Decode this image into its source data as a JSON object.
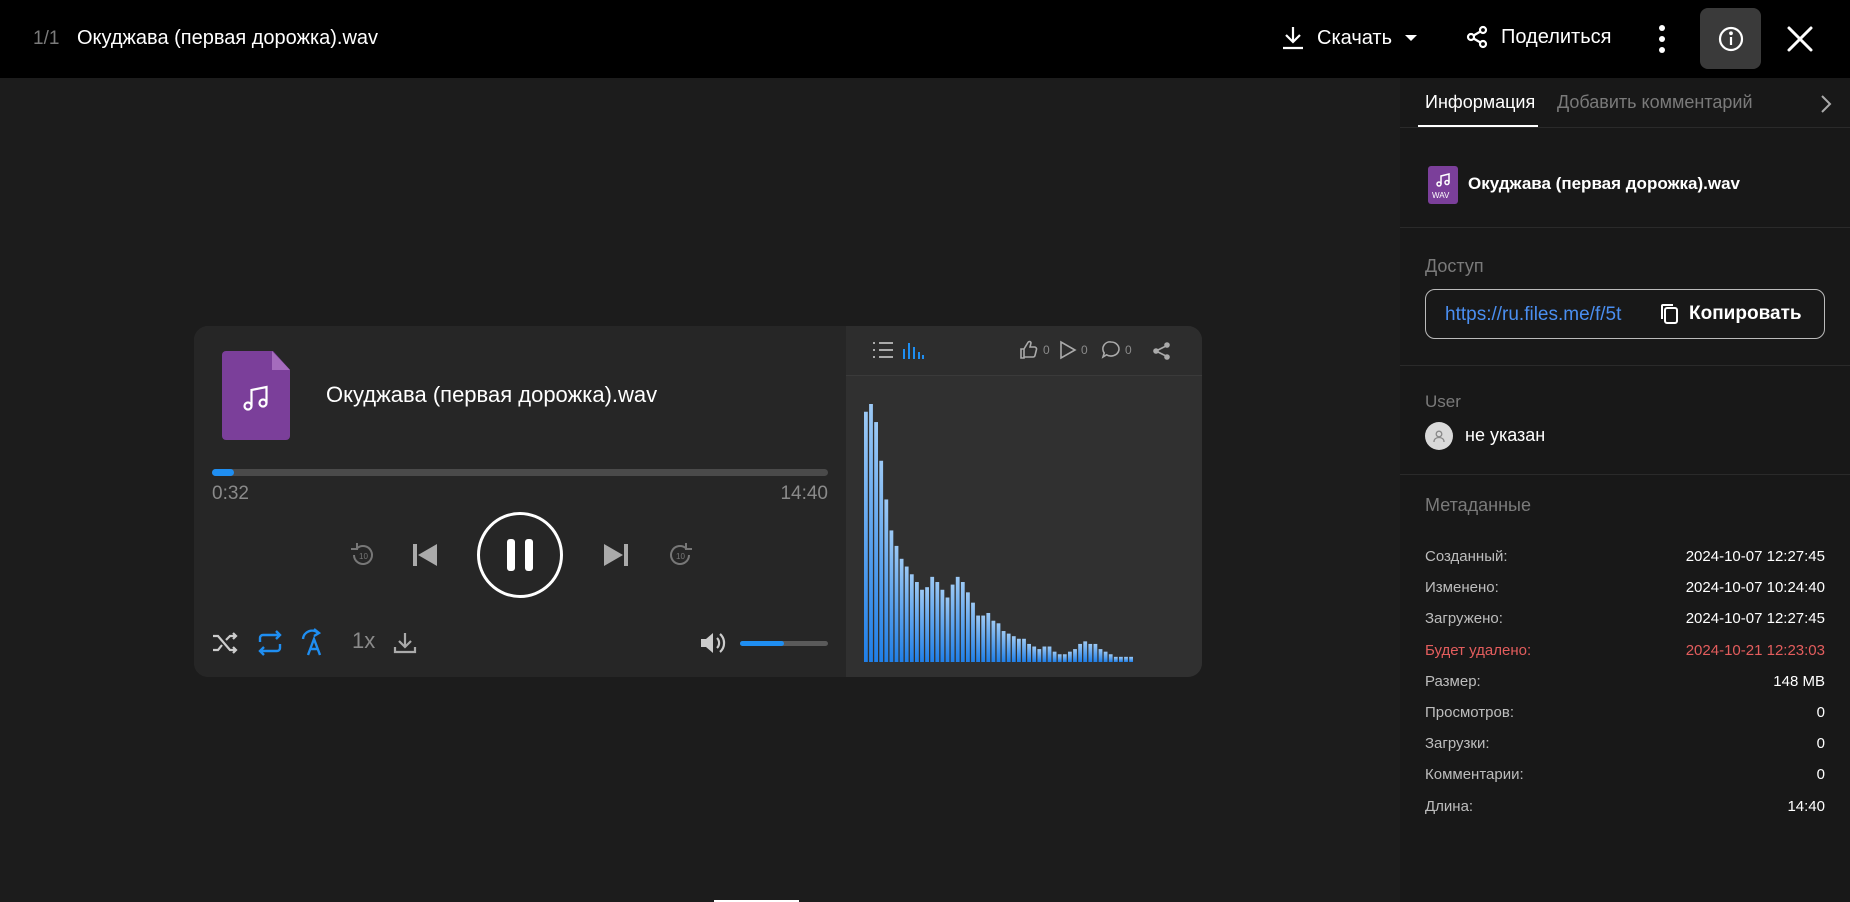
{
  "topbar": {
    "counter": "1/1",
    "title": "Окуджава (первая дорожка).wav",
    "download_label": "Скачать",
    "share_label": "Поделиться"
  },
  "player": {
    "file_title": "Окуджава (первая дорожка).wav",
    "current_time": "0:32",
    "total_time": "14:40",
    "progress": 0.036,
    "speed": "1x",
    "volume": 0.5,
    "accent_color": "#1f8ef1",
    "icons": [
      "replay-10-icon",
      "previous-icon",
      "pause-icon",
      "next-icon",
      "forward-10-icon",
      "shuffle-icon",
      "repeat-icon",
      "auto-translate-icon",
      "download-icon",
      "volume-icon"
    ]
  },
  "visualizer": {
    "likes": "0",
    "plays": "0",
    "comments": "0",
    "levels": [
      0.97,
      1.0,
      0.93,
      0.78,
      0.63,
      0.51,
      0.45,
      0.4,
      0.37,
      0.34,
      0.31,
      0.28,
      0.29,
      0.33,
      0.31,
      0.28,
      0.25,
      0.3,
      0.33,
      0.31,
      0.27,
      0.23,
      0.18,
      0.18,
      0.19,
      0.16,
      0.15,
      0.12,
      0.11,
      0.1,
      0.09,
      0.09,
      0.07,
      0.06,
      0.05,
      0.06,
      0.06,
      0.04,
      0.03,
      0.03,
      0.04,
      0.05,
      0.07,
      0.08,
      0.07,
      0.07,
      0.05,
      0.04,
      0.03,
      0.02,
      0.02,
      0.02,
      0.02
    ]
  },
  "panel": {
    "tab_info": "Информация",
    "tab_comment": "Добавить комментарий",
    "file_name": "Окуджава (первая дорожка).wav",
    "file_ext": "WAV",
    "access_label": "Доступ",
    "access_url": "https://ru.files.me/f/5t",
    "copy_label": "Копировать",
    "user_label": "User",
    "user_value": "не указан",
    "meta_label": "Метаданные",
    "meta": [
      {
        "k": "Созданный:",
        "v": "2024-10-07 12:27:45"
      },
      {
        "k": "Изменено:",
        "v": "2024-10-07 10:24:40"
      },
      {
        "k": "Загружено:",
        "v": "2024-10-07 12:27:45"
      },
      {
        "k": "Будет удалено:",
        "v": "2024-10-21 12:23:03"
      },
      {
        "k": "Размер:",
        "v": "148 MB"
      },
      {
        "k": "Просмотров:",
        "v": "0"
      },
      {
        "k": "Загрузки:",
        "v": "0"
      },
      {
        "k": "Комментарии:",
        "v": "0"
      },
      {
        "k": "Длина:",
        "v": "14:40"
      }
    ],
    "danger_color": "#e35d5d"
  }
}
